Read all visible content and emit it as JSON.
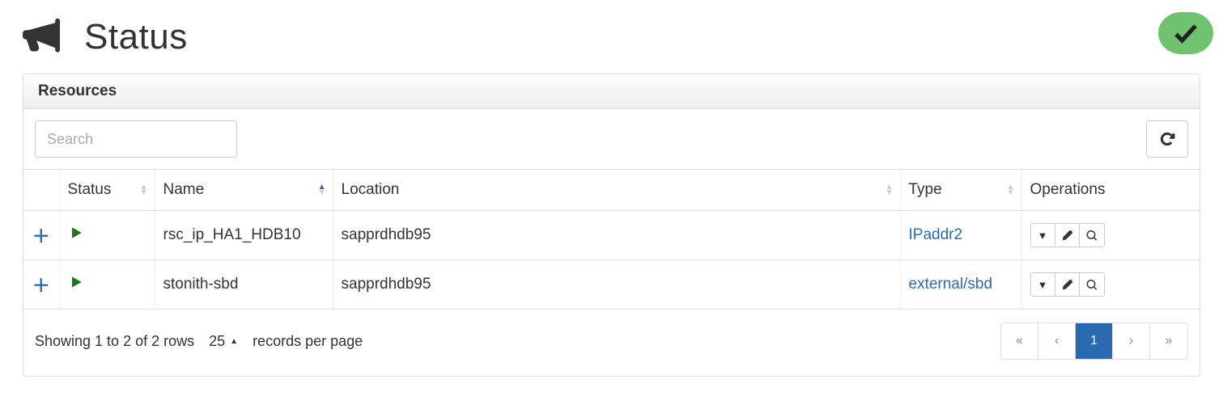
{
  "header": {
    "title": "Status"
  },
  "panel": {
    "heading": "Resources"
  },
  "toolbar": {
    "search_placeholder": "Search"
  },
  "columns": {
    "status": "Status",
    "name": "Name",
    "location": "Location",
    "type": "Type",
    "operations": "Operations"
  },
  "rows": [
    {
      "name": "rsc_ip_HA1_HDB10",
      "location": "sapprdhdb95",
      "type": "IPaddr2"
    },
    {
      "name": "stonith-sbd",
      "location": "sapprdhdb95",
      "type": "external/sbd"
    }
  ],
  "footer": {
    "summary": "Showing 1 to 2 of 2 rows",
    "page_size": "25",
    "page_size_suffix": "records per page"
  },
  "pagination": {
    "first": "«",
    "prev": "‹",
    "current": "1",
    "next": "›",
    "last": "»"
  }
}
